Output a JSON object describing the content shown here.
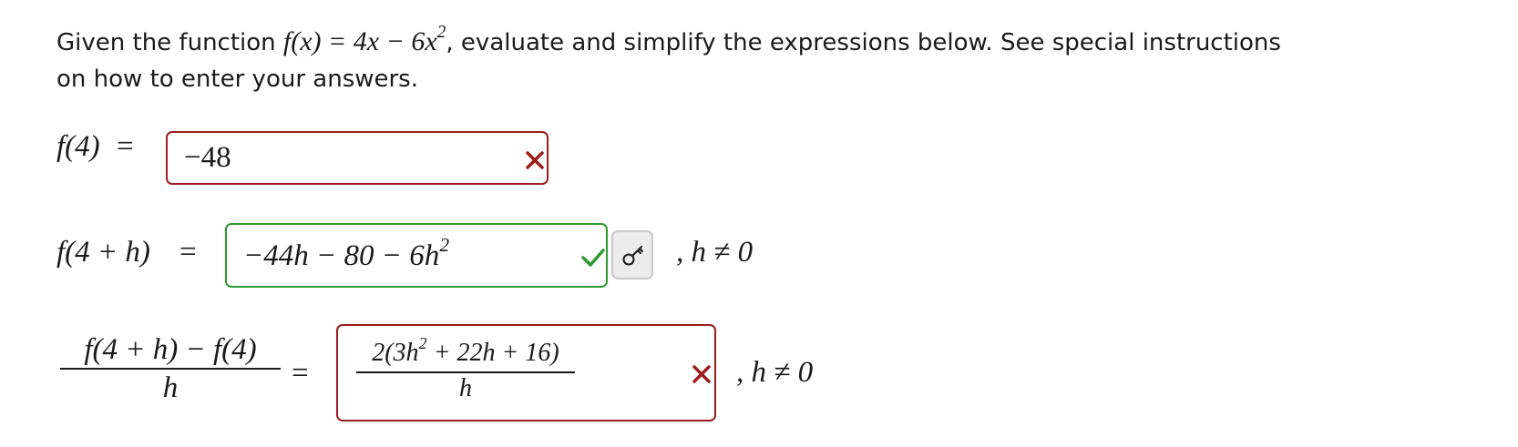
{
  "prompt": {
    "text_before": "Given the function ",
    "function_expr": "f(x) = 4x − 6x",
    "function_exponent": "2",
    "text_after": ", evaluate and simplify the expressions below. See special instructions on how to enter your answers."
  },
  "questions": [
    {
      "label": "f(4)",
      "equals": "=",
      "answer": "−48",
      "status": "incorrect"
    },
    {
      "label": "f(4 + h)",
      "equals": "=",
      "answer_base": "−44h − 80 − 6h",
      "answer_exponent": "2",
      "status": "correct",
      "condition": ", h ≠ 0",
      "key_icon": "key-icon"
    },
    {
      "label_numerator": "f(4 + h) − f(4)",
      "label_denominator": "h",
      "equals": "=",
      "answer_numerator_pre": "2(3h",
      "answer_numerator_exp": "2",
      "answer_numerator_post": " + 22h + 16)",
      "answer_denominator": "h",
      "status": "incorrect",
      "condition": ", h ≠ 0"
    }
  ],
  "colors": {
    "incorrect": "#9d1c1c",
    "correct": "#2f9a2f",
    "key_button_bg": "#ececec"
  }
}
